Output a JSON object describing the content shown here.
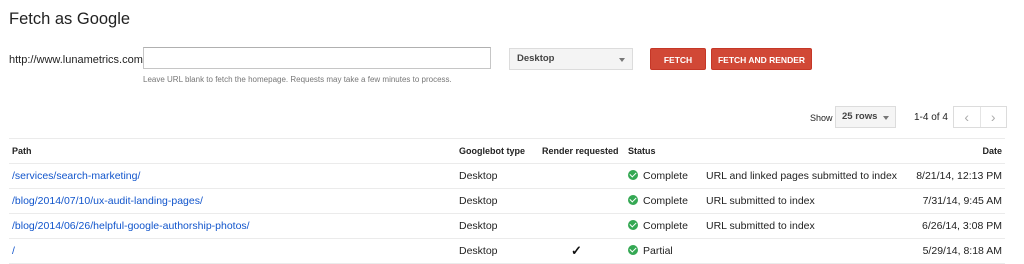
{
  "page_title": "Fetch as Google",
  "fetch_form": {
    "url_prefix": "http://www.lunametrics.com/",
    "url_value": "",
    "url_placeholder": "",
    "hint": "Leave URL blank to fetch the homepage. Requests may take a few minutes to process.",
    "googlebot_type": "Desktop",
    "fetch_label": "FETCH",
    "fetch_render_label": "FETCH AND RENDER"
  },
  "pagination": {
    "show_label": "Show",
    "rows_value": "25 rows",
    "range": "1-4 of 4",
    "prev_icon": "‹",
    "next_icon": "›"
  },
  "table": {
    "headers": {
      "path": "Path",
      "googlebot_type": "Googlebot type",
      "render_requested": "Render requested",
      "status": "Status",
      "date": "Date"
    },
    "rows": [
      {
        "path": "/services/search-marketing/",
        "googlebot_type": "Desktop",
        "render": "",
        "status": "Complete",
        "note": "URL and linked pages submitted to index",
        "date": "8/21/14, 12:13 PM"
      },
      {
        "path": "/blog/2014/07/10/ux-audit-landing-pages/",
        "googlebot_type": "Desktop",
        "render": "",
        "status": "Complete",
        "note": "URL submitted to index",
        "date": "7/31/14, 9:45 AM"
      },
      {
        "path": "/blog/2014/06/26/helpful-google-authorship-photos/",
        "googlebot_type": "Desktop",
        "render": "",
        "status": "Complete",
        "note": "URL submitted to index",
        "date": "6/26/14, 3:08 PM"
      },
      {
        "path": "/",
        "googlebot_type": "Desktop",
        "render": "✓",
        "status": "Partial",
        "note": "",
        "date": "5/29/14, 8:18 AM"
      }
    ]
  },
  "colors": {
    "accent_red": "#d14836",
    "link_blue": "#1155cc",
    "status_green": "#34a853"
  }
}
